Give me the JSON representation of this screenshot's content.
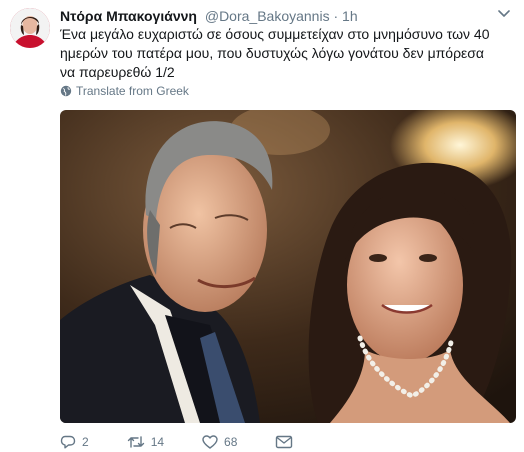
{
  "tweet": {
    "author_name": "Ντόρα Μπακογιάννη",
    "handle": "@Dora_Bakoyannis",
    "separator": "·",
    "time": "1h",
    "text": "Ένα μεγάλο ευχαριστώ σε όσους συμμετείχαν στο μνημόσυνο των 40 ημερών του πατέρα μου, που δυστυχώς λόγω γονάτου δεν μπόρεσα να παρευρεθώ 1/2",
    "translate_label": "Translate from Greek"
  },
  "actions": {
    "replies": "2",
    "retweets": "14",
    "likes": "68"
  },
  "icons": {
    "more": "chevron-down-icon",
    "globe": "globe-icon",
    "reply": "reply-icon",
    "retweet": "retweet-icon",
    "like": "heart-icon",
    "dm": "envelope-icon"
  },
  "colors": {
    "text": "#14171a",
    "secondary": "#657786",
    "avatar_bg": "#c8102e"
  }
}
